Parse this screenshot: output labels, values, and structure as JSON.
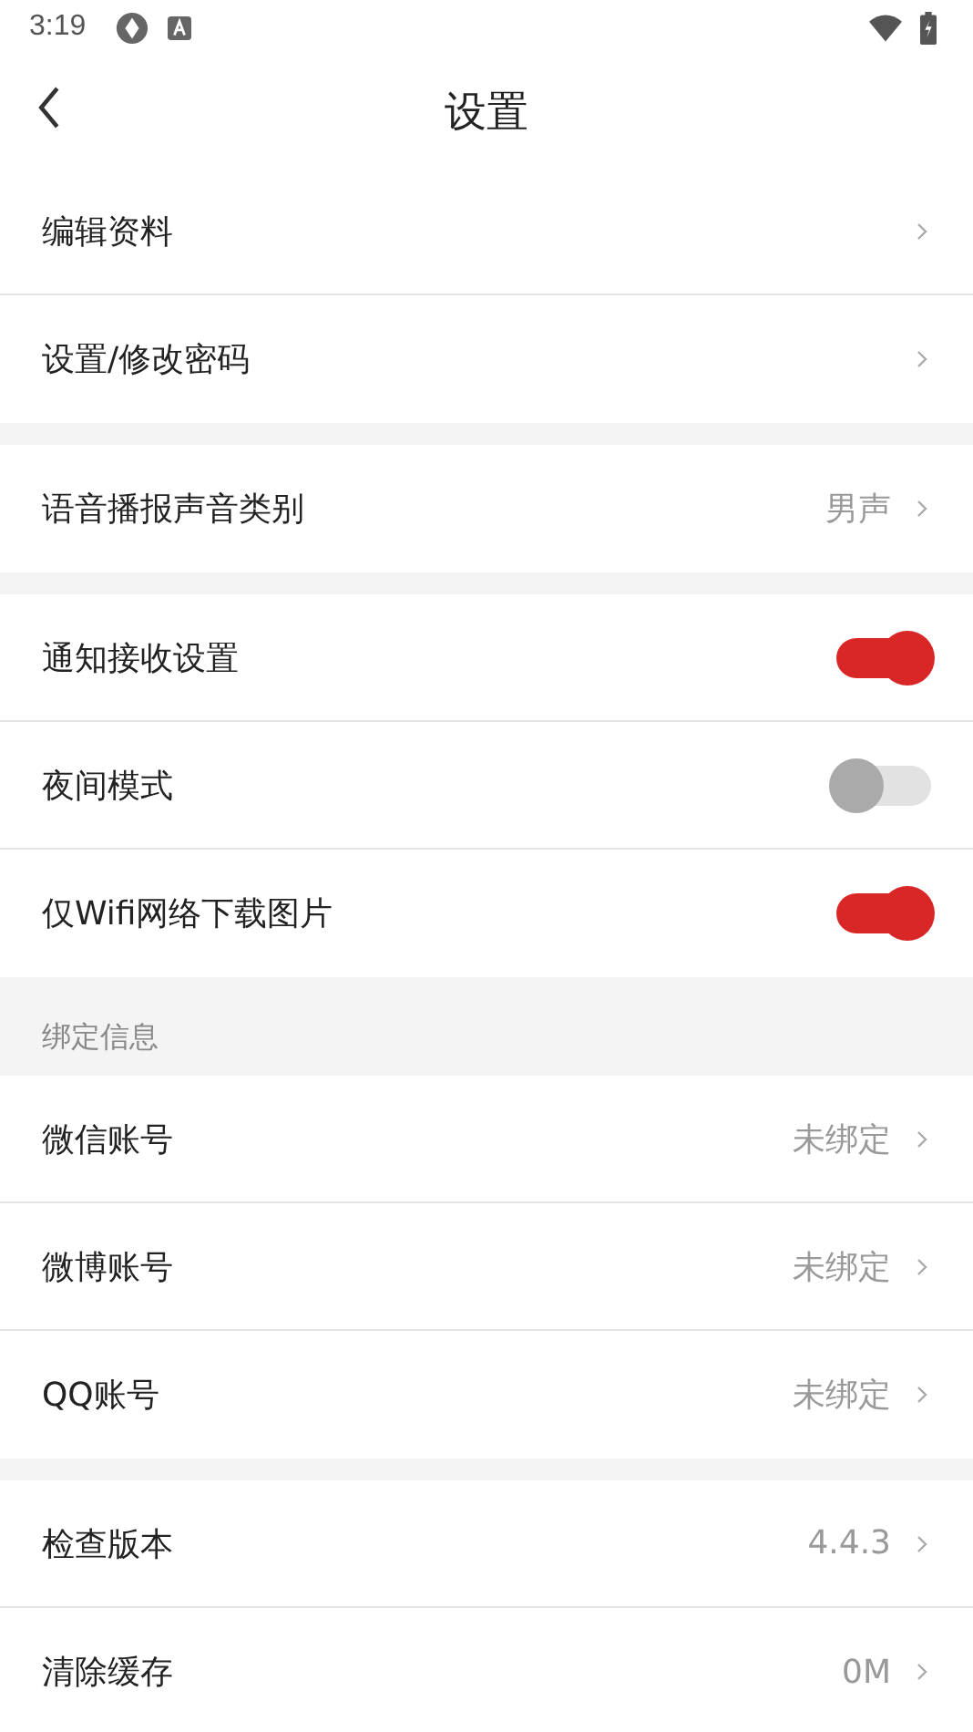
{
  "status_bar": {
    "time": "3:19"
  },
  "header": {
    "title": "设置"
  },
  "groups": [
    {
      "items": [
        {
          "kind": "link",
          "label": "编辑资料"
        },
        {
          "kind": "link",
          "label": "设置/修改密码"
        }
      ]
    },
    {
      "items": [
        {
          "kind": "link",
          "label": "语音播报声音类别",
          "value": "男声"
        }
      ]
    },
    {
      "items": [
        {
          "kind": "toggle",
          "label": "通知接收设置",
          "on": true
        },
        {
          "kind": "toggle",
          "label": "夜间模式",
          "on": false
        },
        {
          "kind": "toggle",
          "label": "仅Wifi网络下载图片",
          "on": true
        }
      ]
    },
    {
      "header": "绑定信息",
      "items": [
        {
          "kind": "link",
          "label": "微信账号",
          "value": "未绑定"
        },
        {
          "kind": "link",
          "label": "微博账号",
          "value": "未绑定"
        },
        {
          "kind": "link",
          "label": "QQ账号",
          "value": "未绑定"
        }
      ]
    },
    {
      "items": [
        {
          "kind": "link",
          "label": "检查版本",
          "value": "4.4.3"
        },
        {
          "kind": "link",
          "label": "清除缓存",
          "value": "0M"
        }
      ]
    }
  ]
}
